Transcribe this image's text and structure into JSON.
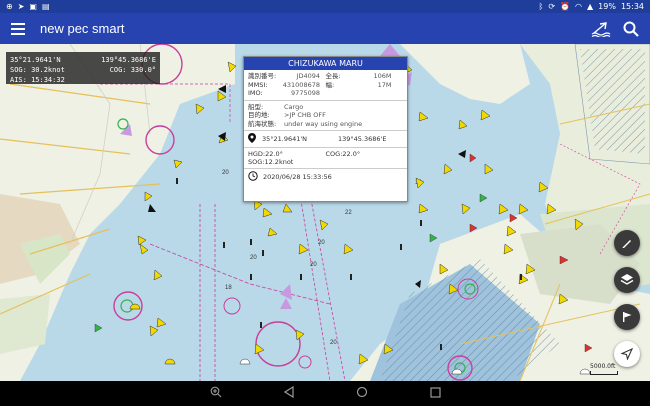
{
  "status_bar": {
    "left_icons": [
      "wifi-assist-icon",
      "location-icon",
      "data-icon",
      "image-icon"
    ],
    "right_icons": [
      "bluetooth-icon",
      "sync-icon",
      "alarm-icon",
      "wifi-icon",
      "signal-icon"
    ],
    "battery": "19%",
    "time": "15:34"
  },
  "app_bar": {
    "title": "new pec smart"
  },
  "coord_overlay": {
    "lat": "35°21.9641'N",
    "lon": "139°45.3686'E",
    "sog": "SOG: 30.2knot",
    "cog": "COG: 330.0°",
    "ais": "AIS: 15:34:32"
  },
  "vessel_popup": {
    "name": "CHIZUKAWA MARU",
    "id_label": "識別番号:",
    "id_value": "JD4094",
    "length_label": "全長:",
    "length_value": "106M",
    "mmsi_label": "MMSI:",
    "mmsi_value": "431008678",
    "width_label": "幅:",
    "width_value": "17M",
    "imo_label": "IMO:",
    "imo_value": "9775098",
    "type_label": "船型:",
    "type_value": "Cargo",
    "dest_label": "目的地:",
    "dest_value": ">JP CHB OFF",
    "status_label": "航海状態:",
    "status_value": "under way using engine",
    "lat": "35°21.9641'N",
    "lon": "139°45.3686'E",
    "hdg": "HGD:22.0°",
    "cog": "COG:22.0°",
    "sog": "SOG:12.2knot",
    "timestamp": "2020/06/28 15:33:56"
  },
  "scale": {
    "label": "5000.0ft"
  },
  "colors": {
    "status_bar": "#1f3d9a",
    "app_bar": "#2743b0",
    "sea": "#b9d8e8",
    "land": "#eef1e4",
    "vessel_yellow": "#f0d800",
    "anchorage_magenta": "#c8409a"
  }
}
